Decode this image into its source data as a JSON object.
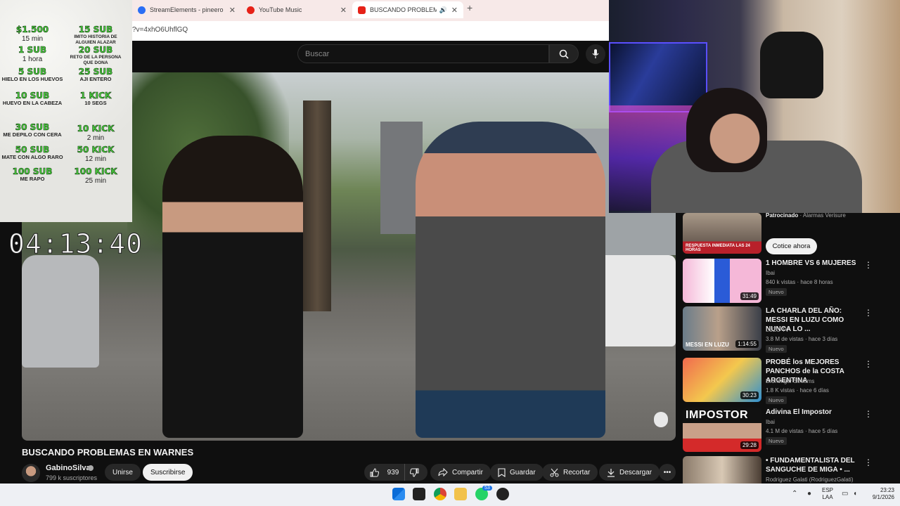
{
  "browser": {
    "tabs": [
      {
        "title": "StreamElements - pineero",
        "fav_color": "#2b6ef5"
      },
      {
        "title": "YouTube Music",
        "fav_color": "#e62117"
      },
      {
        "title": "BUSCANDO PROBLEMAS E",
        "fav_color": "#e62117",
        "active": true
      }
    ],
    "address": "?v=4xhO6UhflGQ"
  },
  "youtube": {
    "search_placeholder": "Buscar",
    "video_title": "BUSCANDO PROBLEMAS EN WARNES",
    "channel": "GabinoSilva",
    "subscribers": "799 k suscriptores",
    "join_label": "Unirse",
    "subscribe_label": "Suscribirse",
    "likes": "939",
    "share_label": "Compartir",
    "save_label": "Guardar",
    "clip_label": "Recortar",
    "download_label": "Descargar"
  },
  "overlay": {
    "timer": "04:13:40",
    "goals_left": [
      {
        "amount": "$1.500",
        "desc": "15 min",
        "time": true
      },
      {
        "amount": "1 SUB",
        "desc": "1 hora",
        "time": true
      },
      {
        "amount": "5 SUB",
        "desc": "HIELO EN LOS HUEVOS"
      },
      {
        "amount": "10 SUB",
        "desc": "HUEVO EN LA CABEZA"
      },
      {
        "amount": "30 SUB",
        "desc": "ME DEPILO CON CERA"
      },
      {
        "amount": "50 SUB",
        "desc": "MATE CON ALGO RARO"
      },
      {
        "amount": "100 SUB",
        "desc": "ME RAPO"
      }
    ],
    "goals_right": [
      {
        "amount": "15 SUB",
        "desc": "IMITO HISTORIA DE ALGUIEN ALAZAR"
      },
      {
        "amount": "20 SUB",
        "desc": "RETO DE LA PERSONA QUE DONA"
      },
      {
        "amount": "25 SUB",
        "desc": "AJI ENTERO"
      },
      {
        "amount": "1 KICK",
        "desc": "10 SEGS"
      },
      {
        "amount": "10 KICK",
        "desc": "2 min",
        "time": true
      },
      {
        "amount": "50 KICK",
        "desc": "12 min",
        "time": true
      },
      {
        "amount": "100 KICK",
        "desc": "25 min",
        "time": true
      }
    ]
  },
  "sidebar": {
    "ad": {
      "label": "Patrocinado",
      "advertiser": "Alarmas Verisure",
      "thumb_text": "RESPUESTA INMEDIATA LAS 24 HORAS",
      "cta": "Cotice ahora"
    },
    "recs": [
      {
        "title": "1 HOMBRE VS 6 MUJERES",
        "channel": "Ibai",
        "meta": "840 k vistas · hace 8 horas",
        "badge": "Nuevo",
        "duration": "31:49",
        "thumb_text": ""
      },
      {
        "title": "LA CHARLA DEL AÑO: MESSI EN LUZU COMO NUNCA LO ...",
        "channel": "LUZU TV",
        "meta": "3.8 M de vistas · hace 3 días",
        "badge": "Nuevo",
        "duration": "1:14:55",
        "thumb_text": "MESSI EN LUZU"
      },
      {
        "title": "PROBÉ los MEJORES PANCHOS de la COSTA ARGENTINA",
        "channel": "Brunenger Streams",
        "meta": "1.8 K vistas · hace 6 días",
        "badge": "Nuevo",
        "duration": "30:23",
        "thumb_text": ""
      },
      {
        "title": "Adivina El Impostor",
        "channel": "Ibai",
        "meta": "4.1 M de vistas · hace 5 días",
        "badge": "Nuevo",
        "duration": "29:28",
        "thumb_text": "IMPOSTOR"
      },
      {
        "title": "• FUNDAMENTALISTA DEL SANGUCHE DE MIGA • ...",
        "channel": "Rodriguez Galati (RodriguezGalati)",
        "meta": "",
        "badge": "",
        "duration": "",
        "thumb_text": ""
      }
    ]
  },
  "taskbar": {
    "lang_top": "ESP",
    "lang_bottom": "LAA",
    "time": "23:23",
    "date": "9/1/2026",
    "whatsapp_badge": "53"
  }
}
